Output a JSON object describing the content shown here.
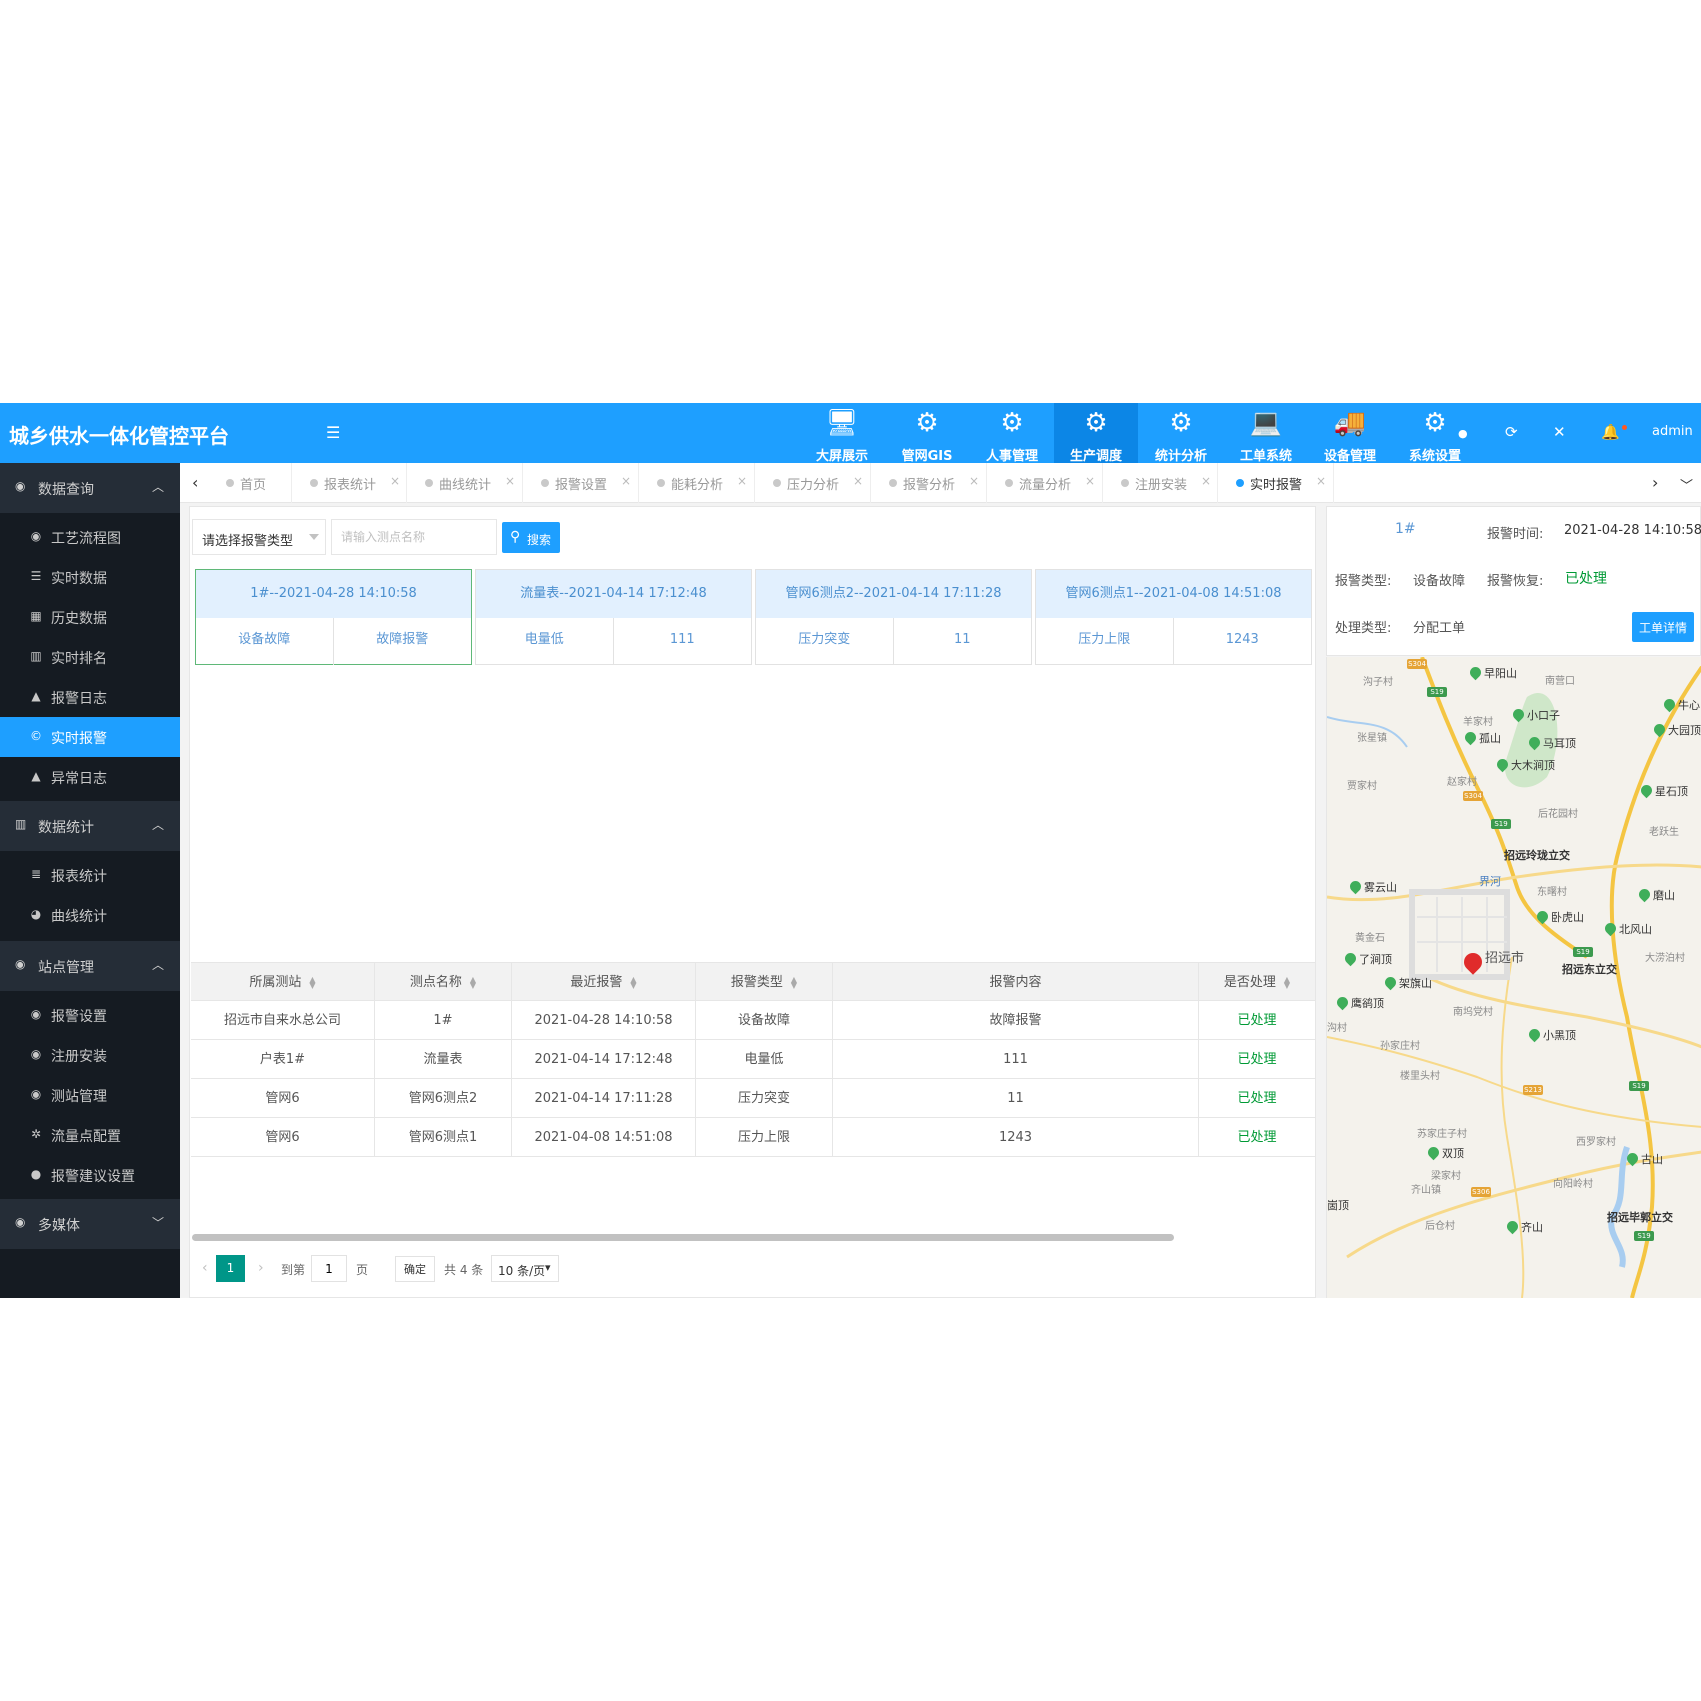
{
  "app": {
    "title": "城乡供水一体化管控平台",
    "user": "admin",
    "accent": "#1e9fff",
    "sidebar_bg": "#151b22",
    "active_tab_color": "#1e9fff"
  },
  "modules": [
    {
      "label": "大屏展示",
      "icon": "monitor-icon"
    },
    {
      "label": "管网GIS",
      "icon": "gears-icon"
    },
    {
      "label": "人事管理",
      "icon": "gears-icon"
    },
    {
      "label": "生产调度",
      "icon": "gears-icon",
      "active": true
    },
    {
      "label": "统计分析",
      "icon": "gears-icon"
    },
    {
      "label": "工单系统",
      "icon": "laptop-icon"
    },
    {
      "label": "设备管理",
      "icon": "truck-icon"
    },
    {
      "label": "系统设置",
      "icon": "gears-icon"
    }
  ],
  "sidebar": {
    "groups": [
      {
        "label": "数据查询",
        "items": [
          "工艺流程图",
          "实时数据",
          "历史数据",
          "实时排名",
          "报警日志",
          "实时报警",
          "异常日志"
        ]
      },
      {
        "label": "数据统计",
        "items": [
          "报表统计",
          "曲线统计"
        ]
      },
      {
        "label": "站点管理",
        "items": [
          "报警设置",
          "注册安装",
          "测站管理",
          "流量点配置",
          "报警建议设置"
        ]
      },
      {
        "label": "多媒体",
        "items": []
      }
    ],
    "active_item": "实时报警"
  },
  "tabs": [
    "首页",
    "报表统计",
    "曲线统计",
    "报警设置",
    "能耗分析",
    "压力分析",
    "报警分析",
    "流量分析",
    "注册安装",
    "实时报警"
  ],
  "filter": {
    "alarm_type_select": "请选择报警类型",
    "station_placeholder": "请输入测点名称",
    "search_label": "搜索"
  },
  "cards": [
    {
      "title": "1#--2021-04-28 14:10:58",
      "left": "设备故障",
      "right": "故障报警"
    },
    {
      "title": "流量表--2021-04-14 17:12:48",
      "left": "电量低",
      "right": "111"
    },
    {
      "title": "管网6测点2--2021-04-14 17:11:28",
      "left": "压力突变",
      "right": "11"
    },
    {
      "title": "管网6测点1--2021-04-08 14:51:08",
      "left": "压力上限",
      "right": "1243"
    }
  ],
  "table": {
    "columns": [
      "所属测站",
      "测点名称",
      "最近报警",
      "报警类型",
      "报警内容",
      "是否处理"
    ],
    "rows": [
      [
        "招远市自来水总公司",
        "1#",
        "2021-04-28 14:10:58",
        "设备故障",
        "故障报警",
        "已处理"
      ],
      [
        "户表1#",
        "流量表",
        "2021-04-14 17:12:48",
        "电量低",
        "111",
        "已处理"
      ],
      [
        "管网6",
        "管网6测点2",
        "2021-04-14 17:11:28",
        "压力突变",
        "11",
        "已处理"
      ],
      [
        "管网6",
        "管网6测点1",
        "2021-04-08 14:51:08",
        "压力上限",
        "1243",
        "已处理"
      ]
    ]
  },
  "pager": {
    "current": "1",
    "goto_label": "到第",
    "goto_value": "1",
    "page_unit": "页",
    "confirm": "确定",
    "total": "共 4 条",
    "page_size": "10 条/页"
  },
  "detail": {
    "station": "1#",
    "alarm_time_label": "报警时间:",
    "alarm_time": "2021-04-28 14:10:58",
    "alarm_type_label": "报警类型:",
    "alarm_type": "设备故障",
    "recover_label": "报警恢复:",
    "recover": "已处理",
    "handle_type_label": "处理类型:",
    "handle_type": "分配工单",
    "work_order_button": "工单详情"
  },
  "map": {
    "places": [
      "沟子村",
      "早阳山",
      "南营口",
      "牛心",
      "张星镇",
      "羊家村",
      "小口子",
      "孤山",
      "马耳顶",
      "大园顶",
      "大木涧顶",
      "贾家村",
      "赵家村",
      "星石顶",
      "后花园村",
      "老跃生",
      "招远玲珑立交",
      "界河",
      "东曙村",
      "雾云山",
      "磨山",
      "卧虎山",
      "北风山",
      "黄金石",
      "招远市",
      "了涧顶",
      "招远东立交",
      "大涝泊村",
      "架旗山",
      "鹰鹆顶",
      "南坞党村",
      "沟村",
      "小黑顶",
      "孙家庄村",
      "楼里头村",
      "苏家庄子村",
      "西罗家村",
      "双顶",
      "梁家村",
      "古山",
      "齐山镇",
      "向阳岭村",
      "崮顶",
      "招远毕郭立交",
      "后仓村",
      "齐山"
    ],
    "shields": [
      "S304",
      "S19",
      "S304",
      "S19",
      "S19",
      "S213",
      "S19",
      "S306",
      "S19"
    ]
  }
}
